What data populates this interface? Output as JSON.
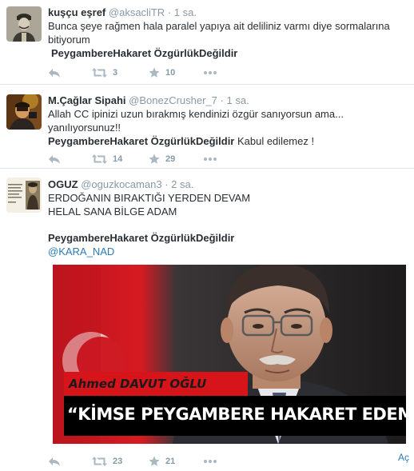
{
  "tweets": [
    {
      "name": "kuşçu eşref",
      "handle": "@aksacliTR",
      "time": "1 sa.",
      "text_line1": "Bunca şeye rağmen hala paralel yapıya ait deliliniz varmı diye sormalarına",
      "text_line2": "bitiyorum",
      "hashtag": "PeygambereHakaret ÖzgürlükDeğildir",
      "retweets": "3",
      "favorites": "10"
    },
    {
      "name": "M.Çağlar Sipahi",
      "handle": "@BonezCrusher_7",
      "time": "1 sa.",
      "text_line1": "Allah CC ipinizi uzun bırakmış kendinizi özgür sanıyorsun ama...",
      "text_line2": "yanılıyorsunuz!!",
      "hashtag": "PeygambereHakaret ÖzgürlükDeğildir",
      "hashtag_suffix": " Kabul edilemez  !",
      "retweets": "14",
      "favorites": "29"
    },
    {
      "name": "OGUZ",
      "handle": "@oguzkocaman3",
      "time": "2 sa.",
      "text_line1": "ERDOĞANIN BIRAKTIĞI YERDEN DEVAM",
      "text_line2": "HELAL SANA BİLGE ADAM",
      "hashtag": "PeygambereHakaret ÖzgürlükDeğildir",
      "mention": "@KARA_NAD",
      "media": {
        "name_caption": "Ahmed DAVUT OĞLU",
        "quote": "“KİMSE PEYGAMBERE HAKARET EDEMEZ”"
      },
      "retweets": "23",
      "favorites": "21"
    }
  ],
  "sep": "·",
  "footer_link": "Aç",
  "colors": {
    "action_icon": "#aab8c2",
    "link": "#2b7bb9",
    "muted": "#8899a6",
    "flag_red": "#e30a17",
    "caption_red": "#d8141b"
  },
  "icons": [
    "reply-icon",
    "retweet-icon",
    "favorite-star-icon",
    "more-dots-icon"
  ]
}
